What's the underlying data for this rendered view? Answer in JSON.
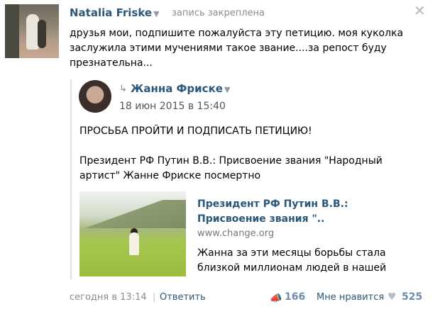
{
  "post": {
    "author": "Natalia Friske",
    "pinned_label": "запись закреплена",
    "text": "друзья мои, подпишите пожалуйста эту петицию. моя куколка заслужила этими мучениями такое звание....за репост буду презнательна...",
    "time": "сегодня в 13:14",
    "separator": "|",
    "reply_label": "Ответить",
    "share_count": "166",
    "like_label": "Мне нравится",
    "like_count": "525"
  },
  "repost": {
    "author": "Жанна Фриске",
    "date": "18 июн 2015 в 15:40",
    "headline": "ПРОСЬБА ПРОЙТИ И ПОДПИСАТЬ ПЕТИЦИЮ!",
    "body": "Президент РФ Путин В.В.: Присвоение звания \"Народный артист\" Жанне Фриске посмертно",
    "link": {
      "title": "Президент РФ Путин В.В.: Присвоение звания \"..",
      "domain": "www.change.org",
      "description": "Жанна за эти месяцы борьбы стала близкой миллионам людей в нашей"
    }
  },
  "icons": {
    "close": "close-icon",
    "repost": "repost-arrow-icon",
    "share": "share-megaphone-icon",
    "like": "heart-icon",
    "caret": "chevron-down-icon"
  },
  "colors": {
    "link": "#2b587a",
    "muted": "#8c8c8c",
    "counter": "#6d8cb0"
  }
}
